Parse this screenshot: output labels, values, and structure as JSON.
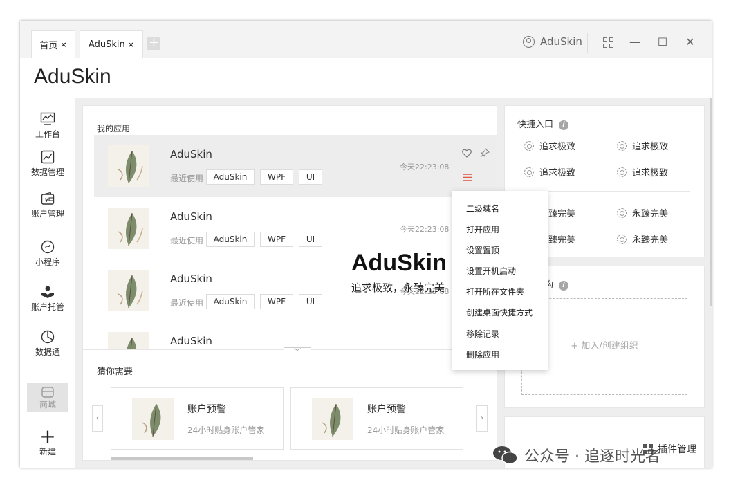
{
  "tabs": [
    {
      "label": "首页",
      "close": "×"
    },
    {
      "label": "AduSkin",
      "close": "×"
    }
  ],
  "tab_add": "+",
  "user": {
    "name": "AduSkin"
  },
  "window_controls": {
    "minimize": "—",
    "maximize": "☐",
    "close": "✕"
  },
  "header": {
    "title": "AduSkin"
  },
  "sidebar": {
    "items": [
      {
        "label": "工作台",
        "icon": "monitor-chart-icon"
      },
      {
        "label": "数据管理",
        "icon": "trend-chart-icon"
      },
      {
        "label": "账户管理",
        "icon": "wallet-icon"
      },
      {
        "label": "小程序",
        "icon": "mini-program-icon"
      },
      {
        "label": "账户托管",
        "icon": "hand-coin-icon"
      },
      {
        "label": "数据通",
        "icon": "pie-chart-icon"
      },
      {
        "label": "商城",
        "icon": "shop-icon"
      }
    ],
    "new_label": "新建"
  },
  "my_apps": {
    "title": "我的应用",
    "recent_label": "最近使用",
    "items": [
      {
        "name": "AduSkin",
        "tags": [
          "AduSkin",
          "WPF",
          "UI"
        ],
        "time": "今天22:23:08"
      },
      {
        "name": "AduSkin",
        "tags": [
          "AduSkin",
          "WPF",
          "UI"
        ],
        "time": "今天22:23:08"
      },
      {
        "name": "AduSkin",
        "tags": [
          "AduSkin",
          "WPF",
          "UI"
        ],
        "time": "今天22:23:08"
      },
      {
        "name": "AduSkin",
        "tags": [],
        "time": ""
      }
    ],
    "expand": "﹀"
  },
  "overlay": {
    "title": "AduSkin",
    "subtitle": "追求极致，永臻完美"
  },
  "guess": {
    "title": "猜你需要",
    "cards": [
      {
        "title": "账户预警",
        "subtitle": "24小时贴身账户管家"
      },
      {
        "title": "账户预警",
        "subtitle": "24小时贴身账户管家"
      }
    ],
    "prev": "‹",
    "next": "›"
  },
  "quick": {
    "title": "快捷入口",
    "info": "i",
    "items": [
      "追求极致",
      "追求极致",
      "追求极致",
      "追求极致",
      "永臻完美",
      "永臻完美",
      "永臻完美",
      "永臻完美"
    ]
  },
  "org": {
    "title": "组织架构",
    "info": "i",
    "add": "+ 加入/创建组织"
  },
  "plugin": {
    "label": "插件管理"
  },
  "context_menu": {
    "items": [
      "二级域名",
      "打开应用",
      "设置置顶",
      "设置开机启动",
      "打开所在文件夹",
      "创建桌面快捷方式",
      "移除记录",
      "删除应用"
    ]
  },
  "watermark": {
    "text": "公众号 · 追逐时光者"
  }
}
